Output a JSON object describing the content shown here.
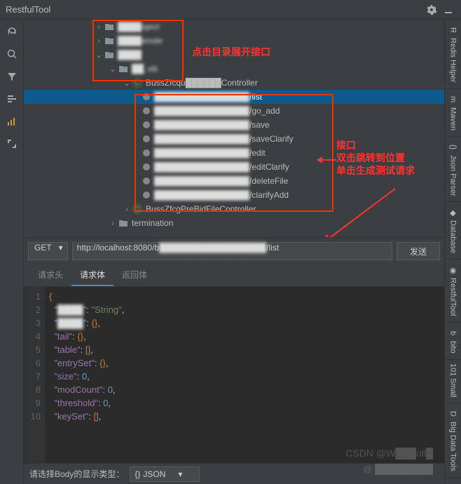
{
  "header": {
    "title": "RestfulTool"
  },
  "annotations": {
    "tree_hint": "点击目录展开接口",
    "api_title": "接口",
    "api_line1": "双击跳转到位置",
    "api_line2": "单击生成测试请求"
  },
  "tree": {
    "items": [
      {
        "indent": 100,
        "chev": "›",
        "icon": "folder",
        "label": "████oject",
        "blur": true
      },
      {
        "indent": 100,
        "chev": "›",
        "icon": "folder",
        "label": "████enote",
        "blur": true
      },
      {
        "indent": 100,
        "chev": "⌄",
        "icon": "folder",
        "label": "████",
        "blur": true
      },
      {
        "indent": 120,
        "chev": "⌄",
        "icon": "folder",
        "label": "██..eb",
        "blur": true
      },
      {
        "indent": 140,
        "chev": "⌄",
        "icon": "class",
        "label": "BussZfcqu██████Controller",
        "blur": false
      }
    ],
    "endpoints": [
      {
        "path": "████████████████",
        "suffix": "/list",
        "selected": true
      },
      {
        "path": "████████████████",
        "suffix": "/go_add"
      },
      {
        "path": "████████████████",
        "suffix": "/save"
      },
      {
        "path": "████████████████",
        "suffix": "/saveClarify"
      },
      {
        "path": "████████████████",
        "suffix": "/edit"
      },
      {
        "path": "████████████████",
        "suffix": "/editClarify"
      },
      {
        "path": "████████████████",
        "suffix": "/deleteFile"
      },
      {
        "path": "████████████████",
        "suffix": "/clarifyAdd"
      }
    ],
    "after": [
      {
        "indent": 140,
        "chev": "›",
        "icon": "class",
        "label": "BussZfcgPreBidFileController",
        "blur": false
      },
      {
        "indent": 120,
        "chev": "›",
        "icon": "folder",
        "label": "termination",
        "blur": false
      }
    ]
  },
  "request": {
    "method": "GET",
    "url_prefix": "http://localhost:8080/b",
    "url_suffix": "/list",
    "send": "发送",
    "tabs": [
      "请求头",
      "请求体",
      "返回体"
    ],
    "active_tab": 1
  },
  "editor": {
    "lines": [
      "{",
      "  \"██\": \"String\",",
      "  \"████\": {},",
      "  \"tail\": {},",
      "  \"table\": [],",
      "  \"entrySet\": {},",
      "  \"size\": 0,",
      "  \"modCount\": 0,",
      "  \"threshold\": 0,",
      "  \"keySet\": [],"
    ]
  },
  "body_type": {
    "label": "请选择Body的显示类型：",
    "value": "JSON"
  },
  "right_tabs": [
    "Redis Helper",
    "Maven",
    "Json Parser",
    "Database",
    "RestfulTool",
    "bito",
    "Small",
    "Big Data Tools"
  ],
  "watermarks": {
    "w1": "CSDN @W███ull█",
    "w2": "@ █████████"
  }
}
